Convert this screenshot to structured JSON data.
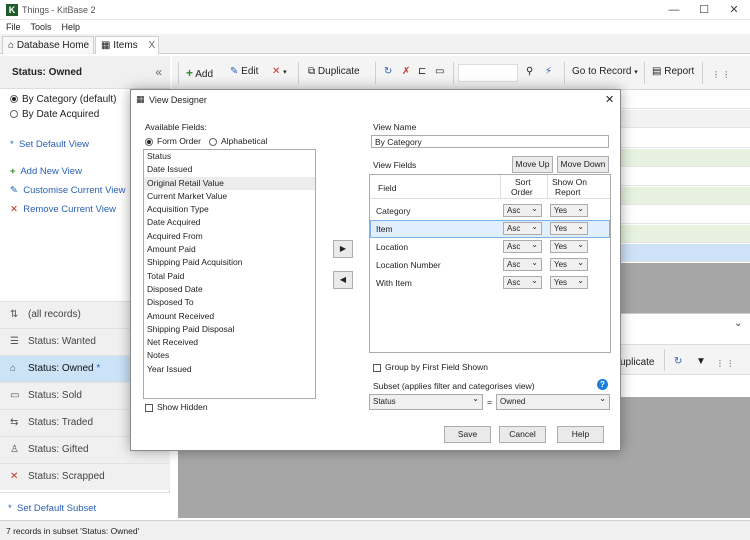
{
  "window": {
    "title": "Things - KitBase 2",
    "app_icon_letter": "K",
    "min": "—",
    "max": "☐",
    "close": "✕"
  },
  "menu": [
    "File",
    "Tools",
    "Help"
  ],
  "tabs": {
    "home": "Database Home",
    "items": "Items",
    "close": "X"
  },
  "toolbar": {
    "add": "Add",
    "edit": "Edit",
    "duplicate": "Duplicate",
    "goto": "Go to Record",
    "report": "Report"
  },
  "left": {
    "header": "Status: Owned",
    "collapse": "«",
    "views": [
      "By Category (default)",
      "By Date Acquired"
    ],
    "set_default_view": "Set Default View",
    "add_new_view": "Add New View",
    "customise_view": "Customise Current View",
    "remove_view": "Remove Current View",
    "subsets": [
      "(all records)",
      "Status: Wanted",
      "Status: Owned",
      "Status: Sold",
      "Status: Traded",
      "Status: Gifted",
      "Status: Scrapped"
    ],
    "set_default_subset": "Set Default Subset"
  },
  "lower_toolbar": {
    "duplicate_partial": "uplicate"
  },
  "statusbar": "7 records in subset 'Status: Owned'",
  "dialog": {
    "title": "View Designer",
    "close": "✕",
    "available_fields_label": "Available Fields:",
    "sort_form": "Form Order",
    "sort_alpha": "Alphabetical",
    "available_fields": [
      "Status",
      "Date Issued",
      "Original Retail Value",
      "Current Market Value",
      "Acquisition Type",
      "Date Acquired",
      "Acquired From",
      "Amount Paid",
      "Shipping Paid Acquisition",
      "Total Paid",
      "Disposed Date",
      "Disposed To",
      "Amount Received",
      "Shipping Paid Disposal",
      "Net Received",
      "Notes",
      "Year Issued"
    ],
    "show_hidden": "Show Hidden",
    "arrow_right": "▶",
    "arrow_left": "◀",
    "view_name_label": "View Name",
    "view_name_value": "By Category",
    "view_fields_label": "View Fields",
    "move_up": "Move Up",
    "move_down": "Move Down",
    "col_field": "Field",
    "col_sort1": "Sort",
    "col_sort2": "Order",
    "col_show1": "Show On",
    "col_show2": "Report",
    "view_fields": [
      {
        "field": "Category",
        "sort": "Asc",
        "show": "Yes"
      },
      {
        "field": "Item",
        "sort": "Asc",
        "show": "Yes"
      },
      {
        "field": "Location",
        "sort": "Asc",
        "show": "Yes"
      },
      {
        "field": "Location Number",
        "sort": "Asc",
        "show": "Yes"
      },
      {
        "field": "With Item",
        "sort": "Asc",
        "show": "Yes"
      }
    ],
    "group_by_first": "Group by First Field Shown",
    "subset_label": "Subset (applies filter and categorises view)",
    "subset_field": "Status",
    "subset_eq": "=",
    "subset_value": "Owned",
    "help_icon": "?",
    "save": "Save",
    "cancel": "Cancel",
    "help": "Help"
  },
  "colors": {
    "selection": "#cbe2f7",
    "row_green": "#e6f2df",
    "row_blue": "#cde2f7",
    "dark_area": "#a6a6a6"
  }
}
